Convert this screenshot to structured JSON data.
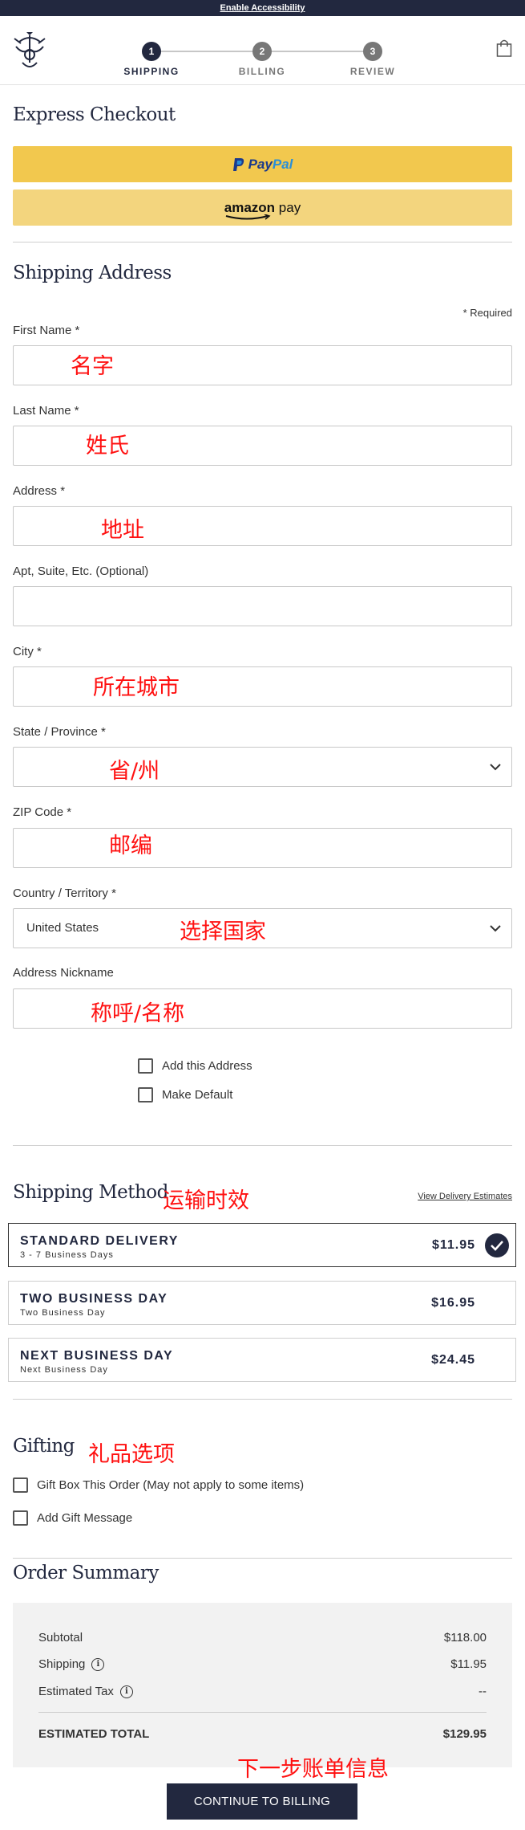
{
  "topbar": {
    "accessibility_link": "Enable Accessibility"
  },
  "header": {
    "steps": [
      {
        "number": "1",
        "label": "SHIPPING",
        "active": true
      },
      {
        "number": "2",
        "label": "BILLING",
        "active": false
      },
      {
        "number": "3",
        "label": "REVIEW",
        "active": false
      }
    ]
  },
  "express": {
    "title": "Express Checkout",
    "paypal_pay": "Pay",
    "paypal_pal": "Pal",
    "amazon_word": "amazon",
    "amazon_pay": "pay"
  },
  "shipping_address": {
    "title": "Shipping Address",
    "required_note": "* Required",
    "fields": {
      "first_name": {
        "label": "First Name *",
        "annotation": "名字",
        "value": ""
      },
      "last_name": {
        "label": "Last Name *",
        "annotation": "姓氏",
        "value": ""
      },
      "address": {
        "label": "Address *",
        "annotation": "地址",
        "value": ""
      },
      "apt": {
        "label": "Apt, Suite, Etc. (Optional)",
        "value": ""
      },
      "city": {
        "label": "City *",
        "annotation": "所在城市",
        "value": ""
      },
      "state": {
        "label": "State / Province *",
        "annotation": "省/州",
        "value": ""
      },
      "zip": {
        "label": "ZIP Code *",
        "annotation": "邮编",
        "value": ""
      },
      "country": {
        "label": "Country / Territory *",
        "annotation": "选择国家",
        "value": "United States"
      },
      "nickname": {
        "label": "Address Nickname",
        "annotation": "称呼/名称",
        "value": ""
      }
    },
    "checkboxes": {
      "add_address": "Add this Address",
      "make_default": "Make Default"
    }
  },
  "shipping_method": {
    "title": "Shipping Method",
    "annotation": "运输时效",
    "estimates_link": "View Delivery Estimates",
    "options": [
      {
        "name": "STANDARD DELIVERY",
        "sub": "3 - 7 Business Days",
        "price": "$11.95",
        "selected": true
      },
      {
        "name": "TWO BUSINESS DAY",
        "sub": "Two Business Day",
        "price": "$16.95",
        "selected": false
      },
      {
        "name": "NEXT BUSINESS DAY",
        "sub": "Next Business Day",
        "price": "$24.45",
        "selected": false
      }
    ]
  },
  "gifting": {
    "title": "Gifting",
    "annotation": "礼品选项",
    "gift_box": "Gift Box This Order (May not apply to some items)",
    "gift_message": "Add Gift Message"
  },
  "order_summary": {
    "title": "Order Summary",
    "subtotal_label": "Subtotal",
    "subtotal": "$118.00",
    "shipping_label": "Shipping",
    "shipping": "$11.95",
    "tax_label": "Estimated Tax",
    "tax": "--",
    "total_label": "ESTIMATED TOTAL",
    "total": "$129.95",
    "info_glyph": "i"
  },
  "cta": {
    "label": "CONTINUE TO BILLING",
    "annotation": "下一步账单信息"
  },
  "colors": {
    "navy": "#22283f",
    "paypal_yellow": "#f2c84e",
    "amazon_yellow": "#f3d57e",
    "annotation_red": "#ff1010"
  }
}
